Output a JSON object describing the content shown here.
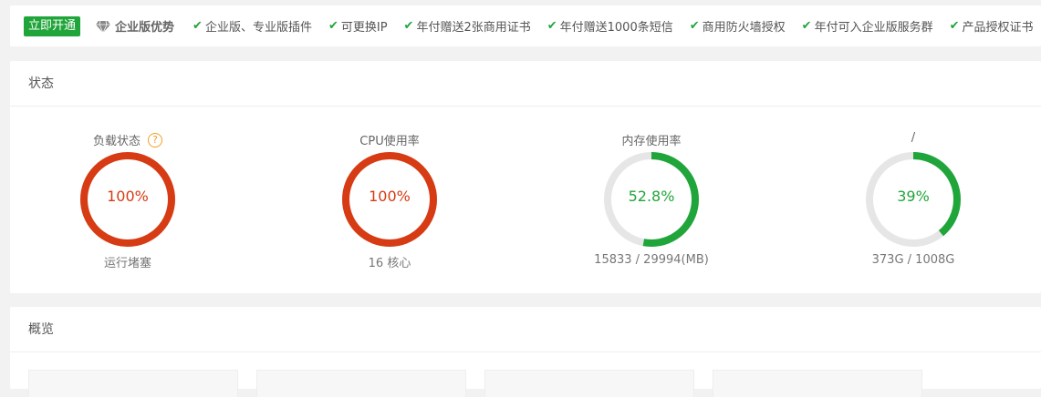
{
  "banner": {
    "activate_label": "立即开通",
    "advantage_title": "企业版优势",
    "features": [
      "企业版、专业版插件",
      "可更换IP",
      "年付赠送2张商用证书",
      "年付赠送1000条短信",
      "商用防火墙授权",
      "年付可入企业版服务群",
      "产品授权证书"
    ]
  },
  "status": {
    "title": "状态",
    "gauges": [
      {
        "title": "负载状态",
        "value": "100%",
        "percent": 100,
        "sub": "运行堵塞",
        "color": "#d63b14",
        "help": "?"
      },
      {
        "title": "CPU使用率",
        "value": "100%",
        "percent": 100,
        "sub": "16 核心",
        "color": "#d63b14"
      },
      {
        "title": "内存使用率",
        "value": "52.8%",
        "percent": 52.8,
        "sub": "15833 / 29994(MB)",
        "color": "#20a53a"
      },
      {
        "title": "/",
        "value": "39%",
        "percent": 39,
        "sub": "373G / 1008G",
        "color": "#20a53a"
      }
    ]
  },
  "overview": {
    "title": "概览"
  },
  "colors": {
    "accent_green": "#20a53a",
    "alert_red": "#d63b14",
    "track_gray": "#e6e6e6"
  }
}
